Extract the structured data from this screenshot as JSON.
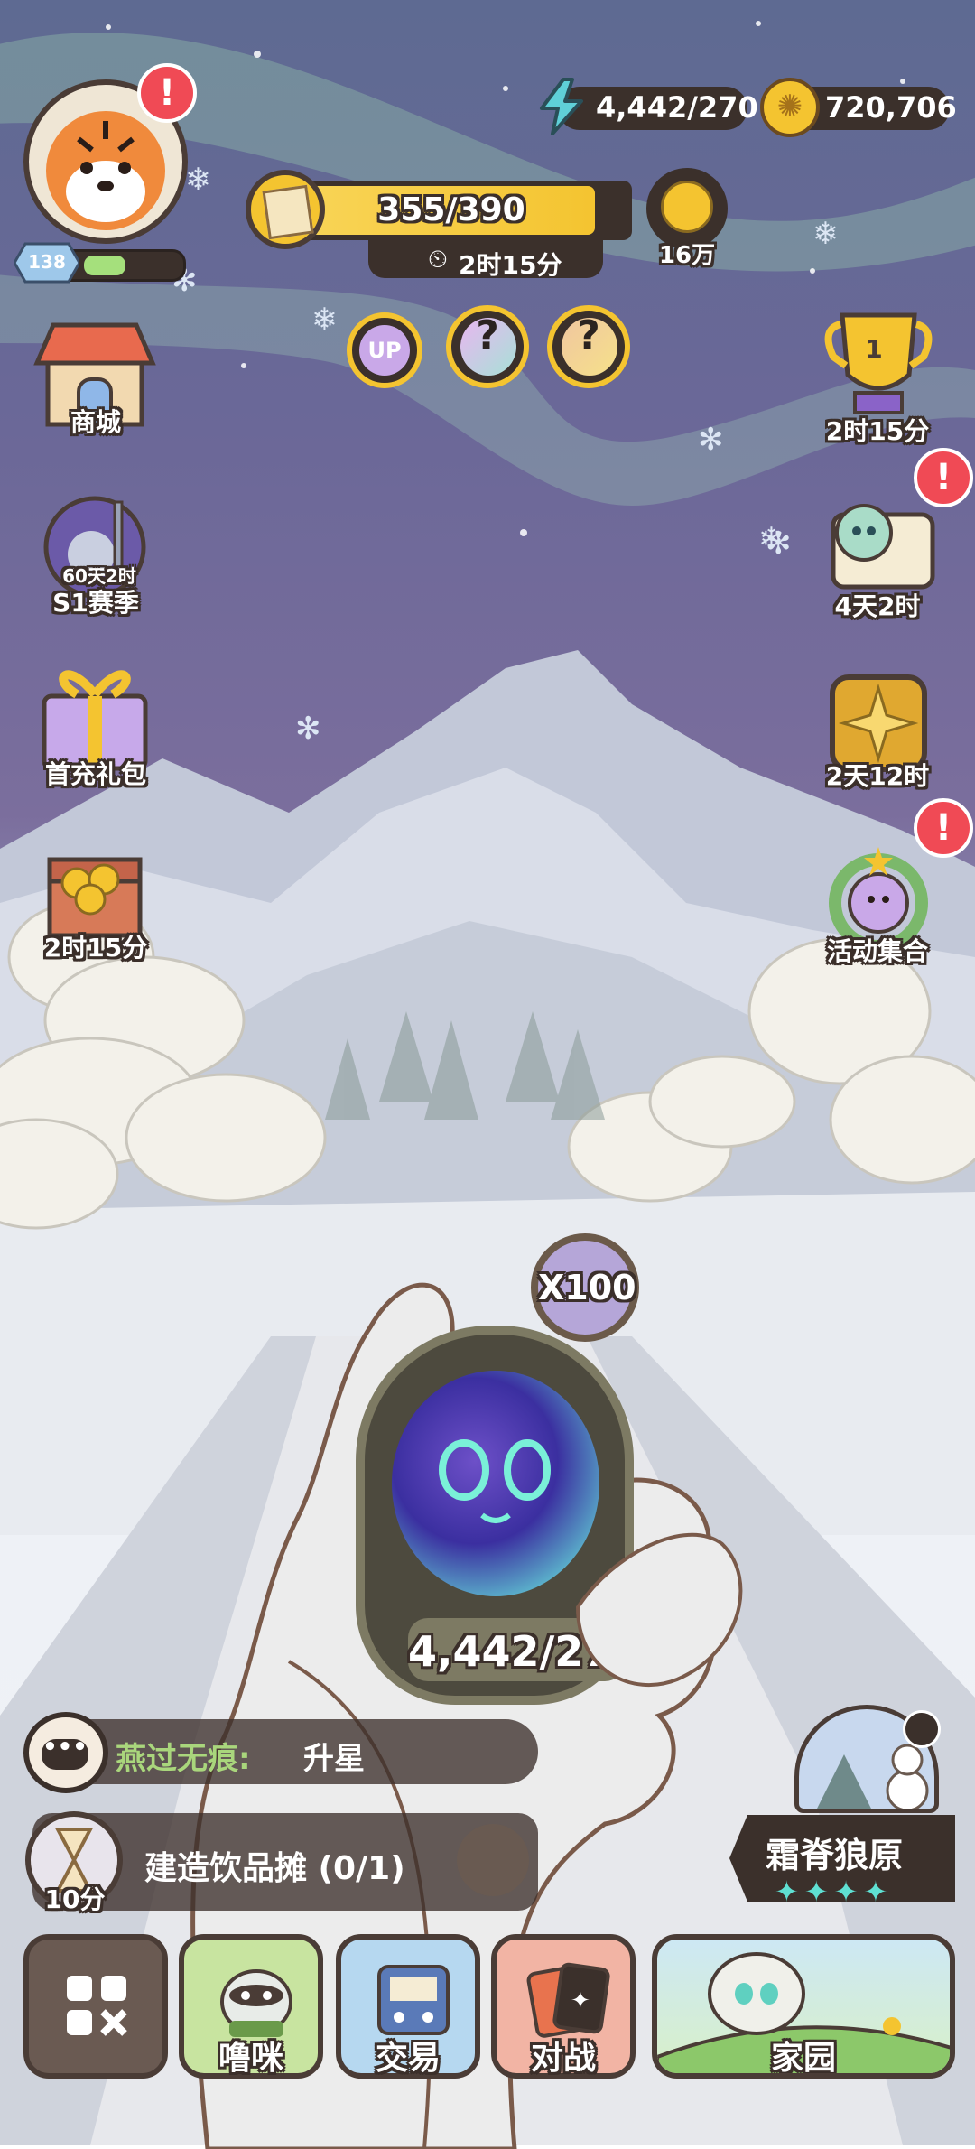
{
  "player": {
    "level": "138",
    "alert": "!"
  },
  "currency": {
    "energy": "4,442/270",
    "coins": "720,706"
  },
  "progress": {
    "value": "355/390",
    "fraction": 0.91,
    "timer": "2时15分",
    "reward": "16万"
  },
  "gacha": {
    "up_badge": "UP",
    "mystery": "?"
  },
  "left_menu": [
    {
      "label": "商城",
      "icon": "shop-icon"
    },
    {
      "label": "S1赛季",
      "sub": "60天2时",
      "icon": "season-knight-icon"
    },
    {
      "label": "首充礼包",
      "icon": "gift-box-icon"
    },
    {
      "label": "2时15分",
      "icon": "treasure-chest-icon"
    }
  ],
  "right_menu": [
    {
      "label": "2时15分",
      "badge": "1",
      "icon": "trophy-icon"
    },
    {
      "label": "4天2时",
      "icon": "scroll-quest-icon"
    },
    {
      "label": "2天12时",
      "icon": "gold-emblem-icon"
    },
    {
      "label": "活动集合",
      "icon": "events-wreath-icon"
    }
  ],
  "pocketwatch": {
    "multiplier": "X100",
    "counter": "4,442/27("
  },
  "chat": {
    "name": "燕过无痕:",
    "message": "升星"
  },
  "task": {
    "title": "建造饮品摊 (0/1)",
    "timer": "10分"
  },
  "location": {
    "name": "霜脊狼原",
    "stars": 4
  },
  "nav": {
    "menu": "",
    "pet": "噜咪",
    "trade": "交易",
    "battle": "对战",
    "home": "家园"
  },
  "colors": {
    "accent_gold": "#f4c430",
    "dark_brown": "#3b302b",
    "alert_red": "#f04a55",
    "teal_star": "#5fe0d3"
  }
}
